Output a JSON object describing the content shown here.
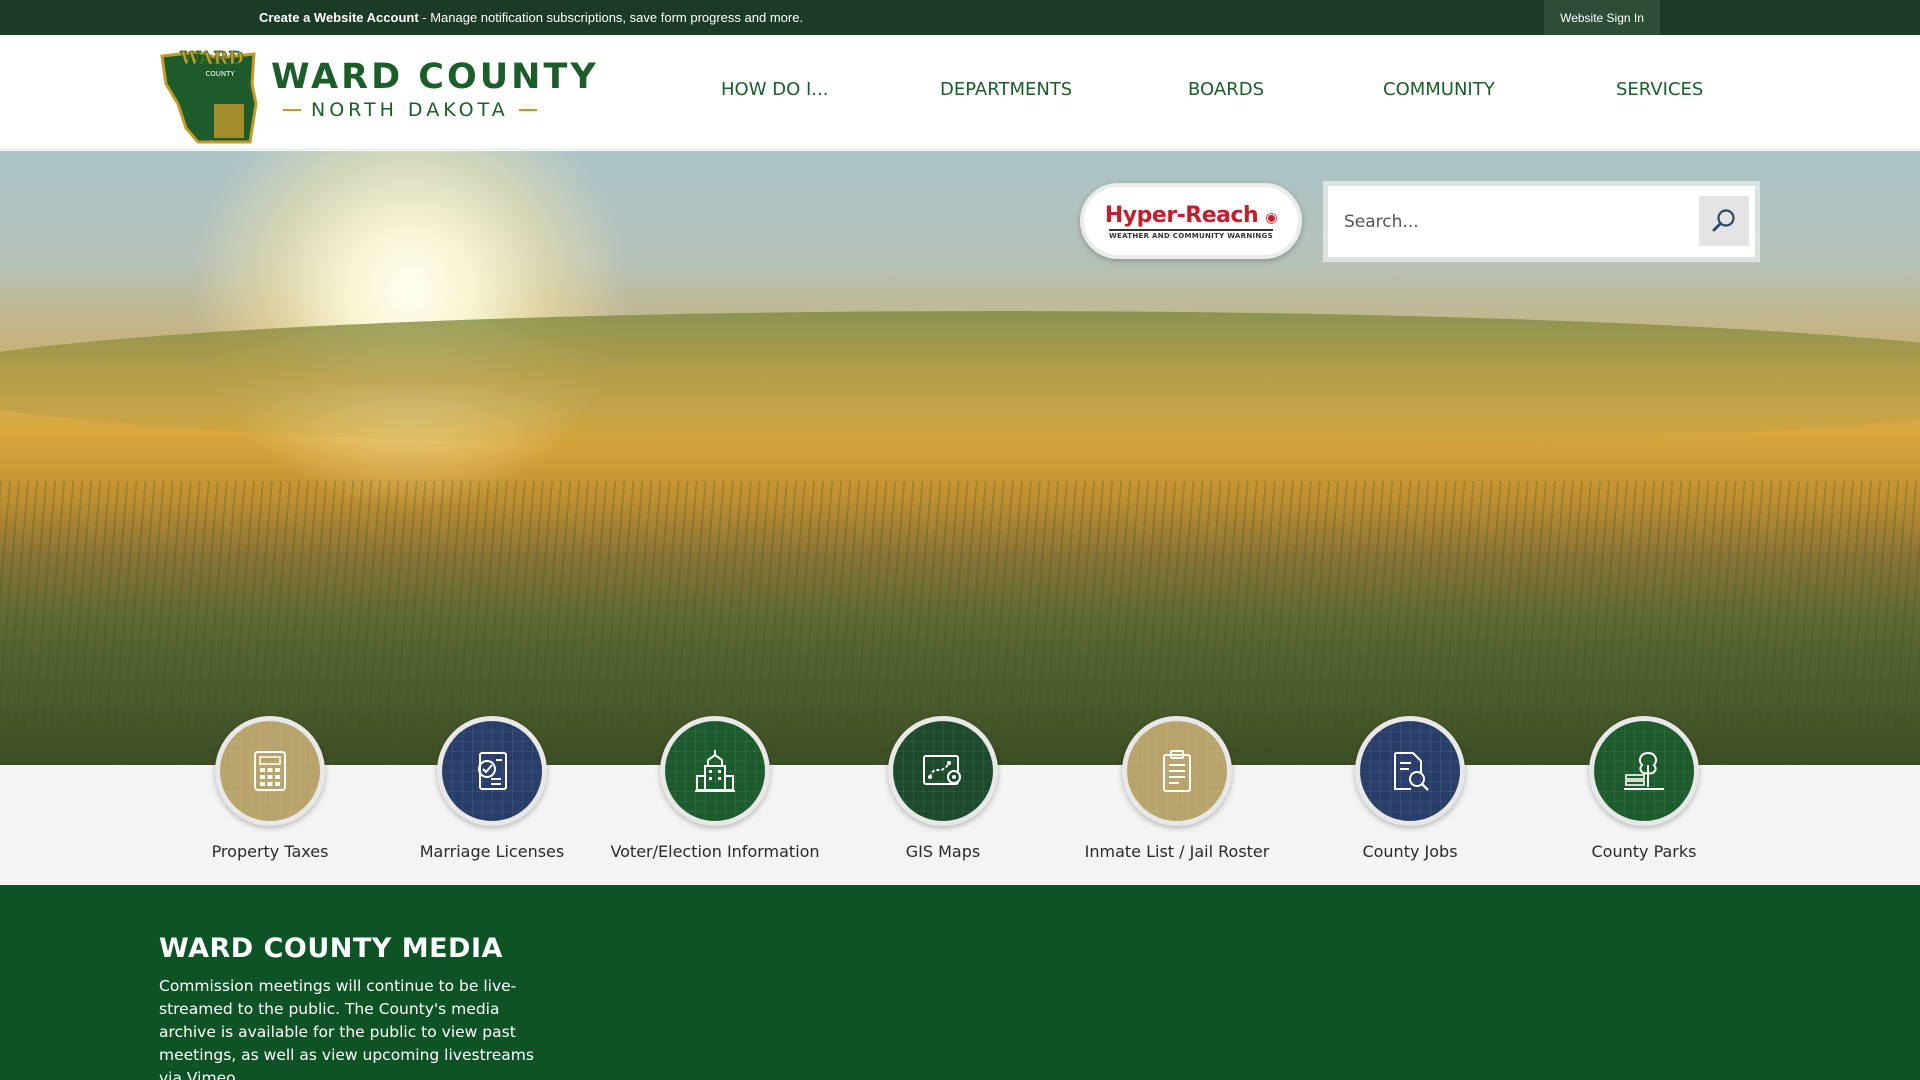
{
  "topbar": {
    "notice_link": "Create a Website Account",
    "notice_text": " - Manage notification subscriptions, save form progress and more.",
    "signin_label": "Website Sign In"
  },
  "header": {
    "logo_icon": "ward-county-seal",
    "brand_title": "WARD COUNTY",
    "brand_subtitle": "NORTH DAKOTA",
    "nav": [
      "HOW DO I...",
      "DEPARTMENTS",
      "BOARDS",
      "COMMUNITY",
      "SERVICES"
    ]
  },
  "hero": {
    "hyperreach_title": "Hyper-Reach",
    "hyperreach_tagline": "WEATHER AND COMMUNITY WARNINGS",
    "search_placeholder": "Search...",
    "search_icon": "magnifier-icon"
  },
  "quick_links": [
    {
      "label": "Property Taxes",
      "icon": "calculator-icon",
      "color": "#b8a46a"
    },
    {
      "label": "Marriage Licenses",
      "icon": "checklist-icon",
      "color": "#283d68"
    },
    {
      "label": "Voter/Election Information",
      "icon": "building-icon",
      "color": "#1c5b2c"
    },
    {
      "label": "GIS Maps",
      "icon": "map-pin-icon",
      "color": "#1d4a2c"
    },
    {
      "label": "Inmate List / Jail Roster",
      "icon": "clipboard-icon",
      "color": "#b8a46a"
    },
    {
      "label": "County Jobs",
      "icon": "document-search-icon",
      "color": "#283d68"
    },
    {
      "label": "County Parks",
      "icon": "tree-bench-icon",
      "color": "#1c5b2c"
    }
  ],
  "media": {
    "title": "WARD COUNTY MEDIA",
    "text": "Commission meetings will continue to be live-streamed to the public. The County's media archive is available for the public to view past meetings, as well as view upcoming livestreams via Vimeo."
  },
  "colors": {
    "brand_green": "#1b5e2a",
    "topbar": "#1c3b26",
    "media_bg": "#0d5325",
    "accent_gold": "#c49a2a"
  }
}
